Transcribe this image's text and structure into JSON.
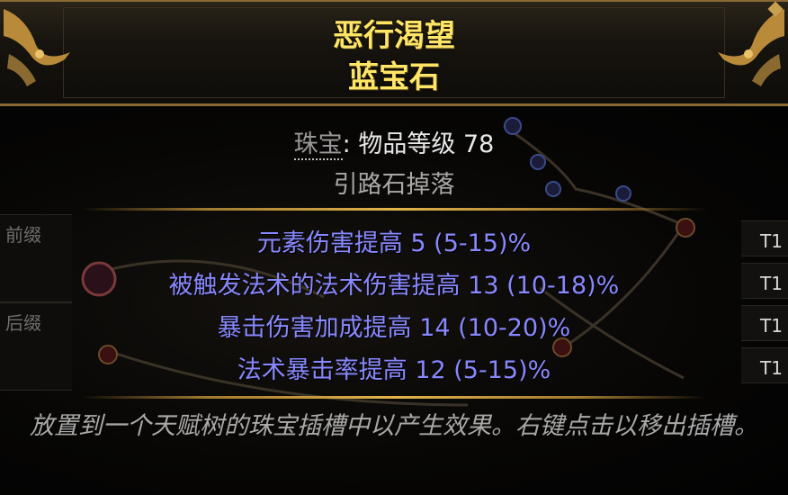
{
  "header": {
    "name": "恶行渴望",
    "base_type": "蓝宝石"
  },
  "properties": {
    "item_class_label": "珠宝",
    "item_level_text": "物品等级 78",
    "drop_source": "引路石掉落"
  },
  "affix_labels": {
    "prefix": "前缀",
    "suffix": "后缀"
  },
  "mods": [
    {
      "text": "元素伤害提高 5 (5-15)%",
      "tier": "T1"
    },
    {
      "text": "被触发法术的法术伤害提高 13 (10-18)%",
      "tier": "T1"
    },
    {
      "text": "暴击伤害加成提高 14 (10-20)%",
      "tier": "T1"
    },
    {
      "text": "法术暴击率提高 12 (5-15)%",
      "tier": "T1"
    }
  ],
  "flavor_text": "放置到一个天赋树的珠宝插槽中以产生效果。右键点击以移出插槽。",
  "colors": {
    "name": "#ffe566",
    "magic_mod": "#8888ff",
    "flavor": "#a9a9a9",
    "frame": "#8a6a34"
  }
}
